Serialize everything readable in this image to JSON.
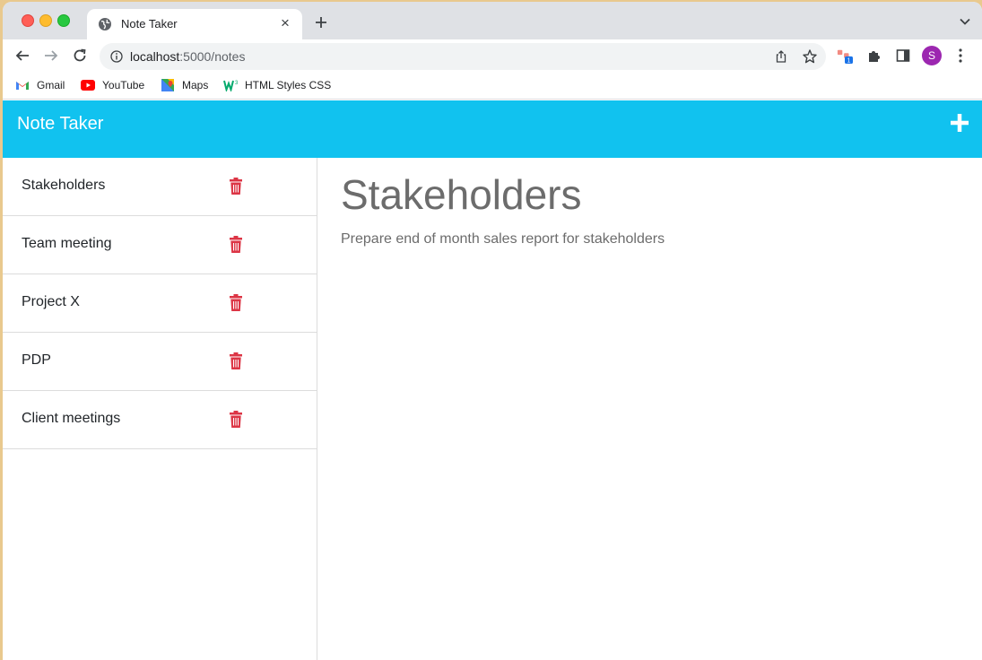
{
  "browser": {
    "tab": {
      "title": "Note Taker",
      "favicon": "globe-icon"
    },
    "url": {
      "host": "localhost",
      "path": ":5000/notes"
    },
    "extension_badge": "1",
    "profile_initial": "S",
    "bookmarks": [
      {
        "label": "Gmail",
        "icon": "gmail-icon"
      },
      {
        "label": "YouTube",
        "icon": "youtube-icon"
      },
      {
        "label": "Maps",
        "icon": "maps-icon"
      },
      {
        "label": "HTML Styles CSS",
        "icon": "w3schools-icon"
      }
    ]
  },
  "app": {
    "brand": "Note Taker",
    "accent_color": "#11c2ef",
    "delete_color": "#dc3545",
    "notes": [
      {
        "title": "Stakeholders"
      },
      {
        "title": "Team meeting"
      },
      {
        "title": "Project X"
      },
      {
        "title": "PDP"
      },
      {
        "title": "Client meetings"
      }
    ],
    "active_note": {
      "title": "Stakeholders",
      "text": "Prepare end of month sales report for stakeholders"
    }
  }
}
